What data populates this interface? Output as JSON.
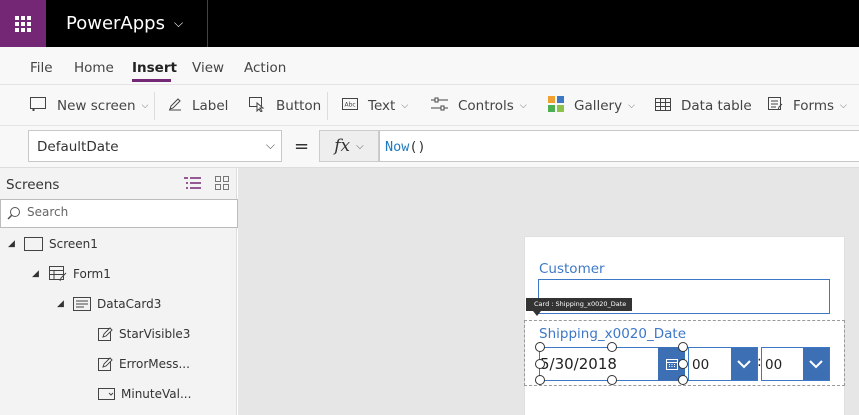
{
  "app": {
    "name": "PowerApps"
  },
  "menu": {
    "tabs": [
      {
        "label": "File"
      },
      {
        "label": "Home"
      },
      {
        "label": "Insert",
        "active": true
      },
      {
        "label": "View"
      },
      {
        "label": "Action"
      }
    ]
  },
  "ribbon": {
    "new_screen": "New screen",
    "label": "Label",
    "button": "Button",
    "text": "Text",
    "controls": "Controls",
    "gallery": "Gallery",
    "data_table": "Data table",
    "forms": "Forms"
  },
  "formula": {
    "property": "DefaultDate",
    "equals": "=",
    "fx": "fx",
    "fn_name": "Now",
    "fn_args": "()"
  },
  "panel": {
    "title": "Screens",
    "search_placeholder": "Search",
    "tree": [
      {
        "label": "Screen1"
      },
      {
        "label": "Form1"
      },
      {
        "label": "DataCard3"
      },
      {
        "label": "StarVisible3"
      },
      {
        "label": "ErrorMess..."
      },
      {
        "label": "MinuteVal..."
      }
    ]
  },
  "canvas": {
    "customer_label": "Customer",
    "tooltip": "Card : Shipping_x0020_Date",
    "shipping_label": "Shipping_x0020_Date",
    "date_value": "5/30/2018",
    "hour_value": "00",
    "colon": ":",
    "minute_value": "00"
  },
  "colors": {
    "brand_purple": "#742774",
    "accent_blue": "#3d78c7",
    "formula_fn": "#1f7bc1"
  }
}
